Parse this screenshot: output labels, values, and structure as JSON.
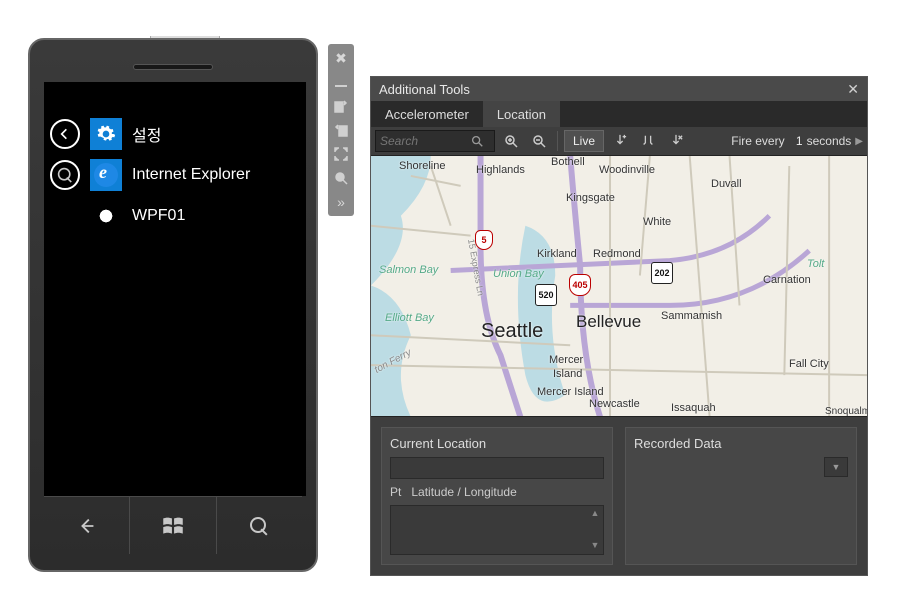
{
  "phone": {
    "apps": [
      {
        "label": "설정",
        "icon": "gear"
      },
      {
        "label": "Internet Explorer",
        "icon": "ie"
      },
      {
        "label": "WPF01",
        "icon": "starburst"
      }
    ]
  },
  "atools": {
    "title": "Additional Tools",
    "tabs": {
      "accelerometer": "Accelerometer",
      "location": "Location"
    },
    "search": {
      "placeholder": "Search"
    },
    "live_label": "Live",
    "fire": {
      "label": "Fire every",
      "value": "1",
      "unit": "seconds"
    },
    "panels": {
      "current": {
        "title": "Current Location",
        "pt": "Pt",
        "coord": "Latitude / Longitude"
      },
      "recorded": {
        "title": "Recorded Data"
      }
    }
  },
  "map": {
    "places": {
      "shoreline": "Shoreline",
      "highlands": "Highlands",
      "bothell": "Bothell",
      "woodinville": "Woodinville",
      "duvall": "Duvall",
      "kingsgate": "Kingsgate",
      "white": "White",
      "kirkland": "Kirkland",
      "redmond": "Redmond",
      "unionbay": "Union Bay",
      "salmonbay": "Salmon Bay",
      "tolt": "Tolt",
      "carnation": "Carnation",
      "elliottbay": "Elliott Bay",
      "seattle": "Seattle",
      "bellevue": "Bellevue",
      "sammamish": "Sammamish",
      "mercer": "Mercer",
      "island": "Island",
      "mercerisland2": "Mercer Island",
      "newcastle": "Newcastle",
      "issaquah": "Issaquah",
      "fallcity": "Fall City",
      "snoqualmie": "Snoqualm",
      "ferry": "ton Ferry",
      "express": "15 Express Ln"
    },
    "shields": {
      "i405": "405",
      "i5": "5",
      "us520": "520",
      "us202": "202"
    }
  }
}
